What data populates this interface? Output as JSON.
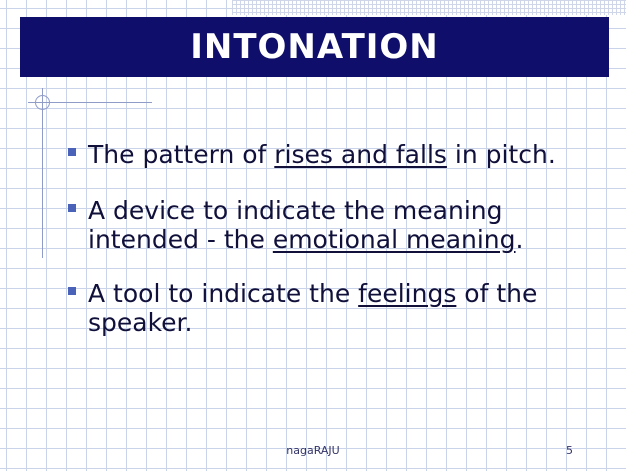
{
  "slide": {
    "title": "INTONATION",
    "bullets": [
      {
        "parts": [
          "The pattern of ",
          "rises and falls",
          " in pitch."
        ]
      },
      {
        "parts": [
          "A device to indicate the meaning intended - the ",
          "emotional meaning",
          "."
        ]
      },
      {
        "parts": [
          "A tool to indicate the ",
          "feelings",
          " of the speaker."
        ]
      }
    ],
    "footer": {
      "author": "nagaRAJU",
      "page_number": "5"
    }
  },
  "colors": {
    "title_bar": "#0f0f6b",
    "title_text": "#ffffff",
    "bullet_marker": "#4a62b8",
    "body_text": "#10103a",
    "grid_line": "#c9d3ea"
  }
}
